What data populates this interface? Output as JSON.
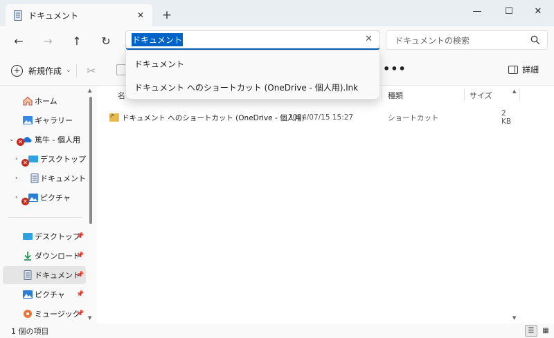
{
  "window": {
    "tab_label": "ドキュメント",
    "tab_close": "✕",
    "new_tab": "+",
    "minimize": "—",
    "maximize": "☐",
    "close": "✕"
  },
  "nav": {
    "back": "←",
    "forward": "→",
    "up": "↑",
    "refresh": "↻"
  },
  "address": {
    "value": "ドキュメント",
    "clear": "✕",
    "suggestions": [
      "ドキュメント",
      "ドキュメント へのショートカット (OneDrive - 個人用).lnk"
    ]
  },
  "search": {
    "placeholder": "ドキュメントの検索"
  },
  "toolbar": {
    "new_label": "新規作成",
    "new_chevron": "⌄",
    "more": "•••",
    "details_label": "詳細"
  },
  "sidebar": {
    "items": [
      {
        "label": "ホーム",
        "icon": "home-icon"
      },
      {
        "label": "ギャラリー",
        "icon": "gallery-icon"
      },
      {
        "label": "篤牛 - 個人用",
        "icon": "onedrive-cloud-icon",
        "chevron": "⌄"
      },
      {
        "label": "デスクトップ",
        "icon": "desktop-icon",
        "chevron": "›"
      },
      {
        "label": "ドキュメント",
        "icon": "document-icon",
        "chevron": "›"
      },
      {
        "label": "ピクチャ",
        "icon": "pictures-icon",
        "chevron": "›"
      }
    ],
    "quick_access": [
      {
        "label": "デスクトップ",
        "icon": "desktop-icon"
      },
      {
        "label": "ダウンロード",
        "icon": "download-icon"
      },
      {
        "label": "ドキュメント",
        "icon": "document-icon"
      },
      {
        "label": "ピクチャ",
        "icon": "pictures-icon"
      },
      {
        "label": "ミュージック",
        "icon": "music-icon"
      }
    ],
    "pin": "📌"
  },
  "columns": {
    "name": "名",
    "type": "種類",
    "size": "サイズ"
  },
  "files": [
    {
      "name": "ドキュメント へのショートカット (OneDrive - 個人用)",
      "date": "2024/07/15 15:27",
      "type": "ショートカット",
      "size": "2 KB"
    }
  ],
  "status": {
    "item_count": "1 個の項目"
  },
  "colors": {
    "accent": "#005fb8",
    "selection": "#0063c8",
    "error": "#c42b1c"
  }
}
